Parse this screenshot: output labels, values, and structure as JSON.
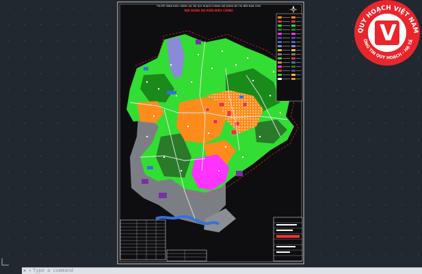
{
  "sheet": {
    "title_line": "THUYẾT MINH ĐIỀU CHỈNH CỤC BỘ QUY HOẠCH CHUNG XÂY DỰNG ĐÔ THỊ ĐẾN NĂM 2030",
    "subtitle": "NỘI DUNG DỰ KIẾN ĐIỀU CHỈNH"
  },
  "logo": {
    "letter": "V",
    "arc_top": "QUY HOẠCH VIỆT NAM",
    "arc_bottom": "THÔNG TIN QUY HOẠCH - HẠ TẦNG",
    "colors": {
      "ring": "#e8262c",
      "inner": "#ffffff",
      "letter_bg": "#e8262c"
    }
  },
  "command_line": {
    "close_symbol": "✕",
    "prompt_symbol": "›",
    "placeholder": "Type a command"
  },
  "colors": {
    "model_space": "#212830",
    "sheet": "#0e0e10",
    "sheet_border": "#ffffff",
    "residential": "#ff8c1a",
    "green": "#33dd33",
    "dark_green": "#1a8a1a",
    "purple_ag": "#7a30a0",
    "public_red": "#e33",
    "magenta": "#ff33ff",
    "water": "#3a6ee0",
    "gray_terrain": "#7b7f85",
    "lake_lavender": "#8a8ad8"
  }
}
